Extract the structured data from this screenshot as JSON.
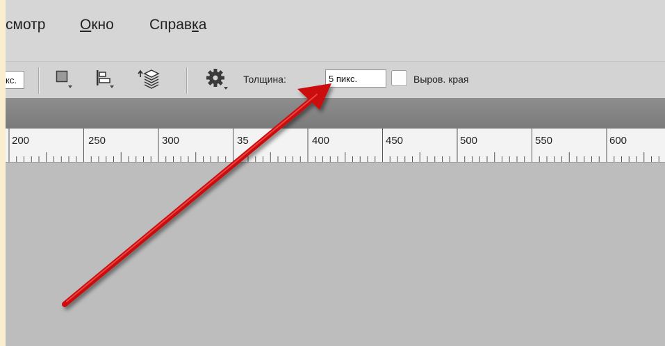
{
  "menubar": {
    "items": [
      {
        "label_pre": "",
        "label_ul": "",
        "label_post": "смотр"
      },
      {
        "label_pre": "",
        "label_ul": "О",
        "label_post": "кно"
      },
      {
        "label_pre": "Справ",
        "label_ul": "к",
        "label_post": "а"
      }
    ]
  },
  "toolbar": {
    "left_field_value": "кс.",
    "thickness_label": "Толщина:",
    "thickness_value": "5 пикс.",
    "smooth_edges_label": "Выров. края",
    "smooth_edges_checked": false,
    "icons": [
      "stroke-square-icon",
      "align-icon",
      "arrange-layers-icon",
      "gear-icon"
    ]
  },
  "ruler": {
    "labels": [
      "200",
      "250",
      "300",
      "35",
      "400",
      "450",
      "500",
      "550",
      "600"
    ]
  },
  "annotation": {
    "arrow_color": "#cc1111"
  }
}
